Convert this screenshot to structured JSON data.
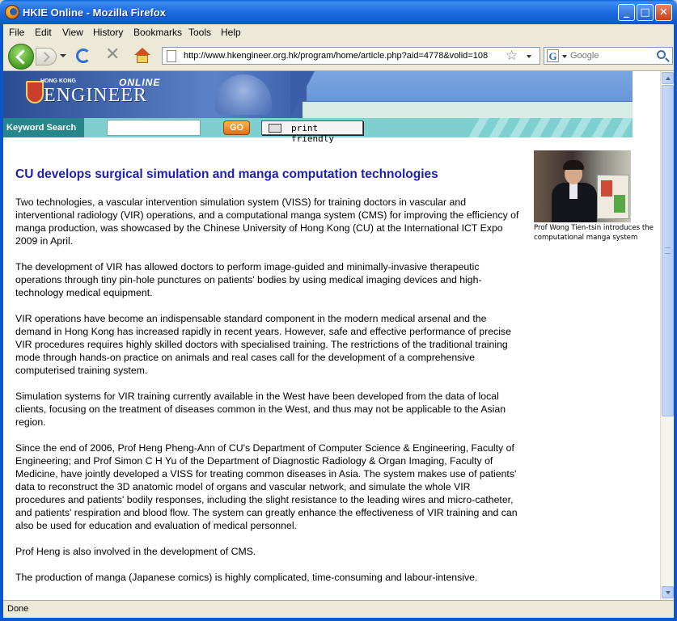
{
  "window": {
    "title": "HKIE Online - Mozilla Firefox"
  },
  "menu": [
    "File",
    "Edit",
    "View",
    "History",
    "Bookmarks",
    "Tools",
    "Help"
  ],
  "nav": {
    "url": "http://www.hkengineer.org.hk/program/home/article.php?aid=4778&volid=108",
    "search_placeholder": "Google"
  },
  "site": {
    "hk_label": "HONG KONG",
    "online_label": "ONLINE",
    "brand": "ENGINEER",
    "keyword_search": "Keyword Search",
    "go": "GO",
    "print": "print friendly"
  },
  "article": {
    "headline": "CU develops surgical simulation and manga computation technologies",
    "paragraphs": [
      "Two technologies, a vascular intervention simulation system (VISS) for training doctors in vascular and interventional radiology (VIR) operations, and a computational manga system (CMS) for improving the efficiency of manga production, was showcased by the Chinese University of Hong Kong (CU) at the International ICT Expo 2009 in April.",
      "The development of VIR has allowed doctors to perform image-guided and minimally-invasive therapeutic operations through tiny pin-hole punctures on patients' bodies by using medical imaging devices and high-technology medical equipment.",
      "VIR operations have become an indispensable standard component in the modern medical arsenal and the demand in Hong Kong has increased rapidly in recent years. However, safe and effective performance of precise VIR procedures requires highly skilled doctors with specialised training. The restrictions of the traditional training mode through hands-on practice on animals and real cases call for the development of a comprehensive computerised training system.",
      "Simulation systems for VIR training currently available in the West have been developed from the data of local clients, focusing on the treatment of diseases common in the West, and thus may not be applicable to the Asian region.",
      "Since the end of 2006, Prof Heng Pheng-Ann of CU's Department of Computer Science & Engineering, Faculty of Engineering; and Prof Simon C H Yu of the Department of Diagnostic Radiology & Organ Imaging, Faculty of Medicine, have jointly developed a VISS for treating common diseases in Asia. The system makes use of patients' data to reconstruct the 3D anatomic model of organs and vascular network, and simulate the whole VIR procedures and patients' bodily responses, including the slight resistance to the leading wires and micro-catheter, and patients' respiration and blood flow. The system can greatly enhance the effectiveness of VIR training and can also be used for education and evaluation of medical personnel.",
      "Prof Heng is also involved in the development of CMS.",
      "The production of manga (Japanese comics) is highly complicated, time-consuming and labour-intensive."
    ],
    "caption": "Prof Wong Tien-tsin introduces the computational manga system"
  },
  "status": {
    "text": "Done"
  }
}
